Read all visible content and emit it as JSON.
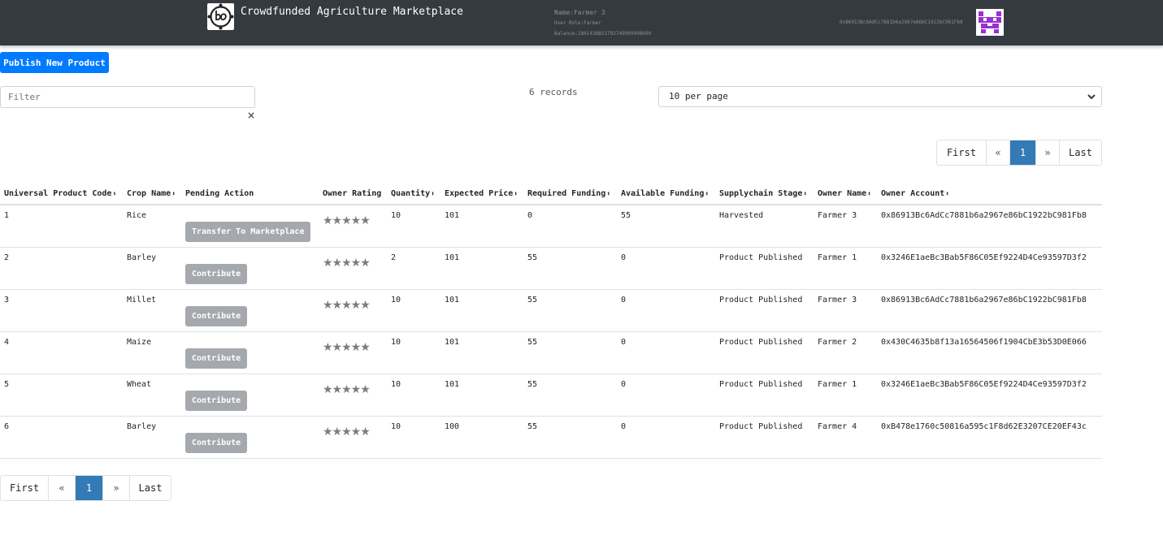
{
  "header": {
    "title": "Crowdfunded Agriculture Marketplace",
    "user_name": "Name:Farmer 3",
    "user_role": "User Role:Farmer",
    "balance": "Balance:1801438851792749999998699",
    "account": "0x86913Bc6AdCc7881b6a2967e86bC1922bC981Fb8"
  },
  "actions": {
    "publish_label": "Publish New Product"
  },
  "filter": {
    "placeholder": "Filter",
    "clear": "×"
  },
  "records": "6 records",
  "per_page": {
    "selected": "10 per page"
  },
  "pagination": {
    "first": "First",
    "prev": "«",
    "current": "1",
    "next": "»",
    "last": "Last"
  },
  "table": {
    "columns": [
      {
        "label": "Universal Product Code",
        "sortable": true
      },
      {
        "label": "Crop Name",
        "sortable": true
      },
      {
        "label": "Pending Action",
        "sortable": false
      },
      {
        "label": "Owner Rating",
        "sortable": false
      },
      {
        "label": "Quantity",
        "sortable": true
      },
      {
        "label": "Expected Price",
        "sortable": true
      },
      {
        "label": "Required Funding",
        "sortable": true
      },
      {
        "label": "Available Funding",
        "sortable": true
      },
      {
        "label": "Supplychain Stage",
        "sortable": true
      },
      {
        "label": "Owner Name",
        "sortable": true
      },
      {
        "label": "Owner Account",
        "sortable": true
      }
    ],
    "sort_icon": "⬍",
    "rows": [
      {
        "upc": "1",
        "crop": "Rice",
        "action": "Transfer To Marketplace",
        "rating": "★★★★★",
        "quantity": "10",
        "price": "101",
        "required": "0",
        "available": "55",
        "stage": "Harvested",
        "owner": "Farmer 3",
        "account": "0x86913Bc6AdCc7881b6a2967e86bC1922bC981Fb8"
      },
      {
        "upc": "2",
        "crop": "Barley",
        "action": "Contribute",
        "rating": "★★★★★",
        "quantity": "2",
        "price": "101",
        "required": "55",
        "available": "0",
        "stage": "Product Published",
        "owner": "Farmer 1",
        "account": "0x3246E1aeBc3Bab5F86C05Ef9224D4Ce93597D3f2"
      },
      {
        "upc": "3",
        "crop": "Millet",
        "action": "Contribute",
        "rating": "★★★★★",
        "quantity": "10",
        "price": "101",
        "required": "55",
        "available": "0",
        "stage": "Product Published",
        "owner": "Farmer 3",
        "account": "0x86913Bc6AdCc7881b6a2967e86bC1922bC981Fb8"
      },
      {
        "upc": "4",
        "crop": "Maize",
        "action": "Contribute",
        "rating": "★★★★★",
        "quantity": "10",
        "price": "101",
        "required": "55",
        "available": "0",
        "stage": "Product Published",
        "owner": "Farmer 2",
        "account": "0x430C4635b8f13a16564506f1904CbE3b53D0E066"
      },
      {
        "upc": "5",
        "crop": "Wheat",
        "action": "Contribute",
        "rating": "★★★★★",
        "quantity": "10",
        "price": "101",
        "required": "55",
        "available": "0",
        "stage": "Product Published",
        "owner": "Farmer 1",
        "account": "0x3246E1aeBc3Bab5F86C05Ef9224D4Ce93597D3f2"
      },
      {
        "upc": "6",
        "crop": "Barley",
        "action": "Contribute",
        "rating": "★★★★★",
        "quantity": "10",
        "price": "100",
        "required": "55",
        "available": "0",
        "stage": "Product Published",
        "owner": "Farmer 4",
        "account": "0xB478e1760c50816a595c1F8d62E3207CE20EF43c"
      }
    ]
  },
  "colors": {
    "navbar": "#343a40",
    "primary": "#007bff",
    "page_active": "#337ab7",
    "action_button": "#a5a9ad",
    "avatar": "#9b2fd0"
  }
}
